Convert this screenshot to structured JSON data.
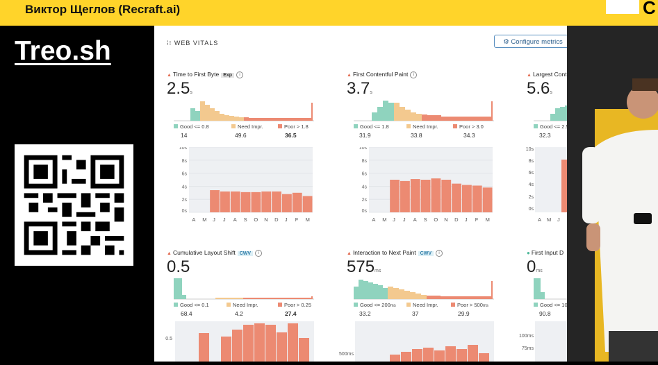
{
  "header": {
    "speaker": "Виктор Щеглов (Recraft.ai)",
    "logo_text": "C"
  },
  "left": {
    "title": "Treo.sh"
  },
  "panel": {
    "section_title": "WEB VITALS",
    "configure_label": "⚙ Configure metrics",
    "metrics": [
      {
        "name": "Time to First Byte",
        "tag": "Exp",
        "value": "2.5",
        "unit": "s",
        "good": "Good <= 0.8",
        "good_u": "s",
        "need": "Need Impr.",
        "poor": "Poor > 1.8",
        "poor_u": "s",
        "good_pct": "14",
        "need_pct": "49.6",
        "poor_pct": "36.5"
      },
      {
        "name": "First Contentful Paint",
        "tag": "",
        "value": "3.7",
        "unit": "s",
        "good": "Good <= 1.8",
        "good_u": "s",
        "need": "Need Impr.",
        "poor": "Poor > 3.0",
        "poor_u": "s",
        "good_pct": "31.9",
        "need_pct": "33.8",
        "poor_pct": "34.3"
      },
      {
        "name": "Largest Cont",
        "tag": "",
        "value": "5.6",
        "unit": "s",
        "good": "Good <= 2.5",
        "good_u": "",
        "need": "",
        "poor": "",
        "poor_u": "",
        "good_pct": "32.3",
        "need_pct": "",
        "poor_pct": ""
      },
      {
        "name": "Cumulative Layout Shift",
        "tag": "CWV",
        "value": "0.5",
        "unit": "",
        "good": "Good <= 0.1",
        "good_u": "",
        "need": "Need Impr.",
        "poor": "Poor > 0.25",
        "poor_u": "",
        "good_pct": "68.4",
        "need_pct": "4.2",
        "poor_pct": "27.4"
      },
      {
        "name": "Interaction to Next Paint",
        "tag": "CWV",
        "value": "575",
        "unit": "ms",
        "good": "Good <= 200",
        "good_u": "ms",
        "need": "Need Impr.",
        "poor": "Poor > 500",
        "poor_u": "ms",
        "good_pct": "33.2",
        "need_pct": "37",
        "poor_pct": "29.9"
      },
      {
        "name": "First Input D",
        "tag": "",
        "value": "0",
        "unit": "ms",
        "good": "Good <= 10",
        "good_u": "",
        "need": "",
        "poor": "",
        "poor_u": "",
        "good_pct": "90.8",
        "need_pct": "",
        "poor_pct": ""
      }
    ],
    "axis_months_full": [
      "A",
      "M",
      "J",
      "J",
      "A",
      "S",
      "O",
      "N",
      "D",
      "J",
      "F",
      "M"
    ],
    "axis_months_short": [
      "A",
      "M",
      "J"
    ],
    "y_ticks_s": [
      "10s",
      "8s",
      "6s",
      "4s",
      "2s",
      "0s"
    ],
    "y_tick_cls": "0.5",
    "y_tick_inp": "500ms",
    "y_ticks_fid": [
      "100ms",
      "75ms"
    ],
    "colors": {
      "good": "#8fd3be",
      "need": "#f3c98f",
      "poor": "#ec8a72",
      "chart_bg": "#eef0f3"
    }
  },
  "chart_data": [
    {
      "type": "bar",
      "title": "Time to First Byte",
      "categories": [
        "A",
        "M",
        "J",
        "J",
        "A",
        "S",
        "O",
        "N",
        "D",
        "J",
        "F",
        "M"
      ],
      "values": [
        0,
        0,
        3.4,
        3.2,
        3.2,
        3.1,
        3.1,
        3.2,
        3.2,
        2.8,
        3.0,
        2.5
      ],
      "ylim": [
        0,
        10
      ]
    },
    {
      "type": "bar",
      "title": "First Contentful Paint",
      "categories": [
        "A",
        "M",
        "J",
        "J",
        "A",
        "S",
        "O",
        "N",
        "D",
        "J",
        "F",
        "M"
      ],
      "values": [
        0,
        0,
        5.0,
        4.8,
        5.1,
        5.0,
        5.2,
        5.0,
        4.4,
        4.2,
        4.1,
        3.8
      ],
      "ylim": [
        0,
        10
      ]
    }
  ]
}
